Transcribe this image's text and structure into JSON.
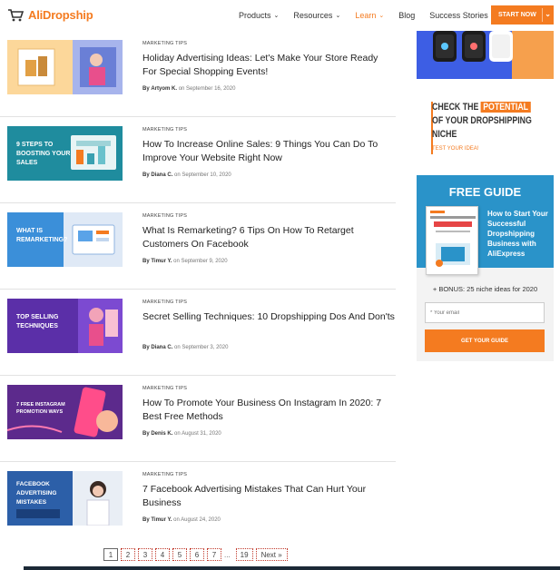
{
  "header": {
    "logo_text": "AliDropship",
    "nav": [
      {
        "label": "Products",
        "chevron": "⌄"
      },
      {
        "label": "Resources",
        "chevron": "⌄"
      },
      {
        "label": "Learn",
        "chevron": "⌄"
      },
      {
        "label": "Blog",
        "chevron": ""
      },
      {
        "label": "Success Stories",
        "chevron": ""
      }
    ],
    "start_label": "START NOW",
    "start_chevron": "⌄"
  },
  "articles": [
    {
      "category": "MARKETING TIPS",
      "title": "Holiday Advertising Ideas: Let's Make Your Store Ready For Special Shopping Events!",
      "by": "By",
      "author": "Artyom K.",
      "on": "on",
      "date": "September 16, 2020",
      "thumb_text": ""
    },
    {
      "category": "MARKETING TIPS",
      "title": "How To Increase Online Sales: 9 Things You Can Do To Improve Your Website Right Now",
      "by": "By",
      "author": "Diana C.",
      "on": "on",
      "date": "September 10, 2020",
      "thumb_text": "9 STEPS TO BOOSTING YOUR SALES"
    },
    {
      "category": "MARKETING TIPS",
      "title": "What Is Remarketing? 6 Tips On How To Retarget Customers On Facebook",
      "by": "By",
      "author": "Timur Y.",
      "on": "on",
      "date": "September 9, 2020",
      "thumb_text": "WHAT IS REMARKETING?"
    },
    {
      "category": "MARKETING TIPS",
      "title": "Secret Selling Techniques: 10 Dropshipping Dos And Don'ts",
      "by": "By",
      "author": "Diana C.",
      "on": "on",
      "date": "September 3, 2020",
      "thumb_text": "TOP SELLING TECHNIQUES"
    },
    {
      "category": "MARKETING TIPS",
      "title": "How To Promote Your Business On Instagram In 2020: 7 Best Free Methods",
      "by": "By",
      "author": "Denis K.",
      "on": "on",
      "date": "August 31, 2020",
      "thumb_text": "7 FREE INSTAGRAM PROMOTION WAYS"
    },
    {
      "category": "MARKETING TIPS",
      "title": "7 Facebook Advertising Mistakes That Can Hurt Your Business",
      "by": "By",
      "author": "Timur Y.",
      "on": "on",
      "date": "August 24, 2020",
      "thumb_text": "FACEBOOK ADVERTISING MISTAKES"
    }
  ],
  "pagination": {
    "pages": [
      "1",
      "2",
      "3",
      "4",
      "5",
      "6",
      "7"
    ],
    "ellipsis": "...",
    "last": "19",
    "next": "Next »"
  },
  "sidebar": {
    "potential": {
      "line1_a": "CHECK THE",
      "line1_b": "POTENTIAL",
      "line2": "OF YOUR DROPSHIPPING",
      "line3": "NICHE",
      "small": "TEST YOUR IDEA!"
    },
    "guide": {
      "title": "FREE GUIDE",
      "desc": "How to Start Your Successful Dropshipping Business with AliExpress",
      "bonus": "+ BONUS: 25 niche ideas for 2020",
      "email_placeholder": "* Your email",
      "button": "GET YOUR GUIDE"
    }
  },
  "colors": {
    "brand": "#f47b20",
    "guide_blue": "#2a93c9",
    "ad_blue": "#3d5ee4"
  }
}
